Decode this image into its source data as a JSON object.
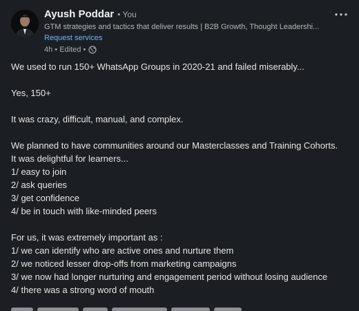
{
  "post": {
    "author": {
      "name": "Ayush Poddar",
      "degree": "• You",
      "headline": "GTM strategies and tactics that deliver results | B2B Growth, Thought Leadershi...",
      "request_services": "Request services",
      "timestamp": "4h • Edited •",
      "visibility_icon": "globe-icon"
    },
    "menu_icon": "more-horizontal-icon",
    "lines": [
      "We used to run 150+ WhatsApp Groups in 2020-21 and failed miserably...",
      "",
      "Yes, 150+",
      "",
      "It was crazy, difficult, manual, and complex.",
      "",
      "We planned to have communities around our Masterclasses and Training Cohorts.",
      "It was delightful for learners...",
      "1/ easy to join",
      "2/ ask queries",
      "3/ get confidence",
      "4/ be in touch with like-minded peers",
      "",
      "For us, it was extremely important as :",
      "1/ we can identify who are active ones and nurture them",
      "2/ we noticed lesser drop-offs from marketing campaigns",
      "3/ we now had longer nurturing and engagement period without losing audience",
      "4/ there was a strong word of mouth"
    ]
  },
  "colors": {
    "background": "#1b1f23",
    "link": "#70b5f9",
    "text": "#e6e6e6"
  }
}
